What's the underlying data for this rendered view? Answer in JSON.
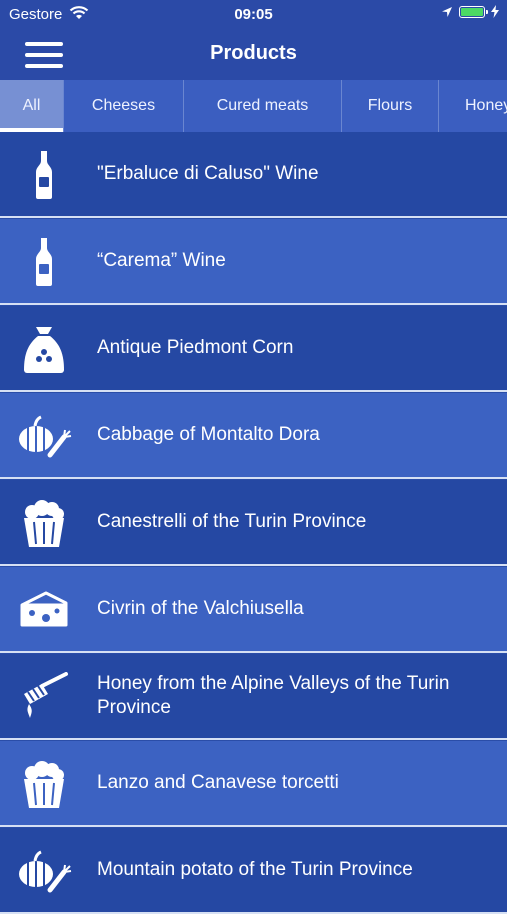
{
  "status_bar": {
    "carrier": "Gestore",
    "time": "09:05"
  },
  "nav": {
    "title": "Products",
    "menu_icon": "hamburger-menu-icon"
  },
  "tabs": [
    {
      "label": "All",
      "active": true
    },
    {
      "label": "Cheeses",
      "active": false
    },
    {
      "label": "Cured meats",
      "active": false
    },
    {
      "label": "Flours",
      "active": false
    },
    {
      "label": "Honey",
      "active": false
    }
  ],
  "products": [
    {
      "label": "\"Erbaluce di Caluso\" Wine",
      "icon": "wine-bottle-icon"
    },
    {
      "label": "“Carema” Wine",
      "icon": "wine-bottle-icon"
    },
    {
      "label": "Antique Piedmont Corn",
      "icon": "flour-sack-icon"
    },
    {
      "label": "Cabbage of Montalto Dora",
      "icon": "vegetables-icon"
    },
    {
      "label": "Canestrelli of the Turin Province",
      "icon": "basket-icon"
    },
    {
      "label": "Civrin of the Valchiusella",
      "icon": "cheese-icon"
    },
    {
      "label": "Honey from the Alpine Valleys of the Turin Province",
      "icon": "honey-dipper-icon"
    },
    {
      "label": "Lanzo and Canavese torcetti",
      "icon": "basket-icon"
    },
    {
      "label": "Mountain potato of the Turin Province",
      "icon": "vegetables-icon"
    }
  ],
  "colors": {
    "row_dark": "#2548a3",
    "row_light": "#3c62c2",
    "battery_fill": "#4cd964"
  }
}
